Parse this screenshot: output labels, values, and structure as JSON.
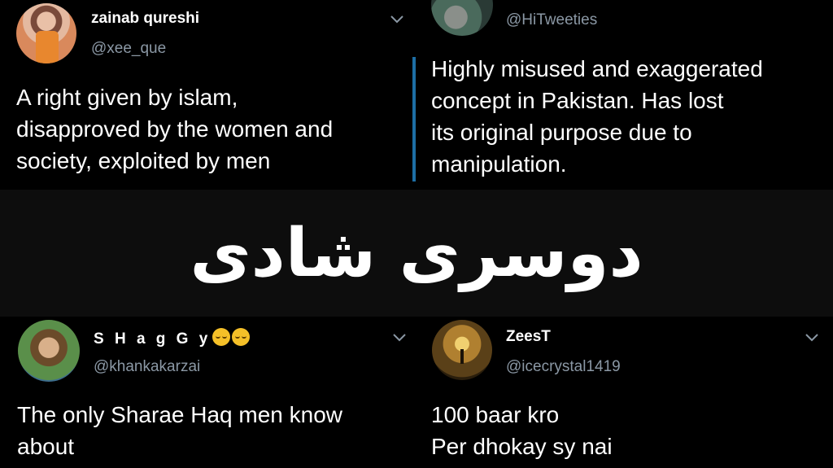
{
  "tweets": [
    {
      "name": "zainab qureshi",
      "handle": "@xee_que",
      "text": "A right given by islam, disapproved by the women and society, exploited by men",
      "lines": [
        "A right given by islam,",
        "disapproved by the women and",
        "society, exploited by men"
      ]
    },
    {
      "name": "",
      "handle": "@HiTweeties",
      "lines": [
        "Highly misused and exaggerated",
        "concept in Pakistan. Has lost",
        "its original purpose due to",
        "manipulation."
      ]
    },
    {
      "name": "S H a g G y",
      "handle": "@khankakarzai",
      "lines": [
        "The only Sharae Haq men know",
        "about"
      ]
    },
    {
      "name": "ZeesT",
      "handle": "@icecrystal1419",
      "lines": [
        "100 baar kro",
        "Per dhokay sy nai"
      ]
    }
  ],
  "banner": {
    "text": "دوسری شادی"
  },
  "colors": {
    "background": "#000000",
    "handle": "#8b98a5",
    "thread_line": "#1d6fa5"
  }
}
